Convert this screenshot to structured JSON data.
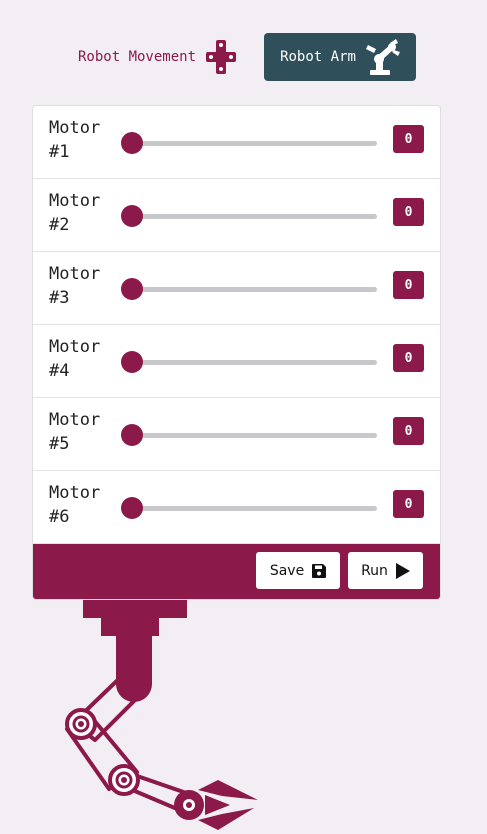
{
  "nav": {
    "movement_label": "Robot Movement",
    "movement_icon": "dpad-icon",
    "arm_label": "Robot Arm",
    "arm_icon": "robot-arm-icon"
  },
  "motors": [
    {
      "label": "Motor #1",
      "value": "0",
      "level": 0
    },
    {
      "label": "Motor #2",
      "value": "0",
      "level": 0
    },
    {
      "label": "Motor #3",
      "value": "0",
      "level": 0
    },
    {
      "label": "Motor #4",
      "value": "0",
      "level": 0
    },
    {
      "label": "Motor #5",
      "value": "0",
      "level": 0
    },
    {
      "label": "Motor #6",
      "value": "0",
      "level": 0
    }
  ],
  "actions": {
    "save_label": "Save",
    "save_icon": "floppy-disk-icon",
    "run_label": "Run",
    "run_icon": "play-icon"
  },
  "colors": {
    "accent": "#8b1a4a",
    "active_tab": "#2f4f5a",
    "background": "#f3eef3"
  }
}
